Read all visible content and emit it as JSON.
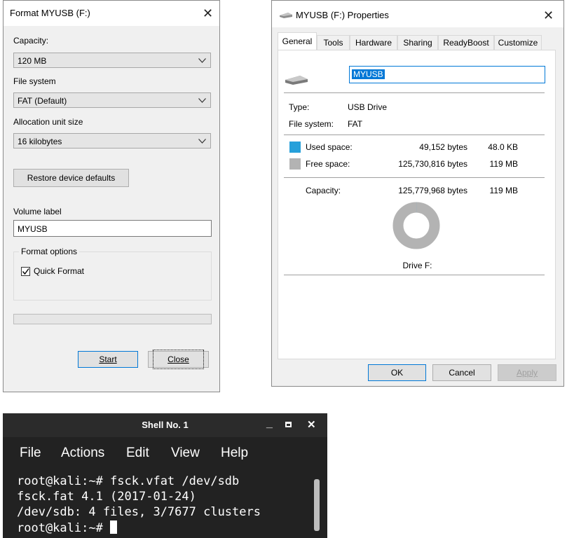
{
  "format_dialog": {
    "title": "Format MYUSB (F:)",
    "capacity_label": "Capacity:",
    "capacity_value": "120 MB",
    "filesystem_label": "File system",
    "filesystem_value": "FAT (Default)",
    "allocation_label": "Allocation unit size",
    "allocation_value": "16 kilobytes",
    "restore_button": "Restore device defaults",
    "volume_label": "Volume label",
    "volume_value": "MYUSB",
    "options_label": "Format options",
    "quick_format_label": "Quick Format",
    "quick_format_checked": true,
    "start_button": "Start",
    "close_button": "Close"
  },
  "properties_dialog": {
    "title": "MYUSB (F:) Properties",
    "tabs": [
      "General",
      "Tools",
      "Hardware",
      "Sharing",
      "ReadyBoost",
      "Customize"
    ],
    "active_tab": "General",
    "drive_name": "MYUSB",
    "type_label": "Type:",
    "type_value": "USB Drive",
    "fs_label": "File system:",
    "fs_value": "FAT",
    "used_label": "Used space:",
    "used_bytes": "49,152 bytes",
    "used_size": "48.0 KB",
    "free_label": "Free space:",
    "free_bytes": "125,730,816 bytes",
    "free_size": "119 MB",
    "capacity_label": "Capacity:",
    "capacity_bytes": "125,779,968 bytes",
    "capacity_size": "119 MB",
    "drive_caption": "Drive F:",
    "used_color": "#26a0da",
    "free_color": "#b3b3b3",
    "used_fraction": 0.0004,
    "ok_button": "OK",
    "cancel_button": "Cancel",
    "apply_button": "Apply"
  },
  "terminal": {
    "title": "Shell No. 1",
    "menu": [
      "File",
      "Actions",
      "Edit",
      "View",
      "Help"
    ],
    "lines": [
      "root@kali:~# fsck.vfat /dev/sdb",
      "fsck.fat 4.1 (2017-01-24)",
      "/dev/sdb: 4 files, 3/7677 clusters",
      "root@kali:~# "
    ]
  }
}
